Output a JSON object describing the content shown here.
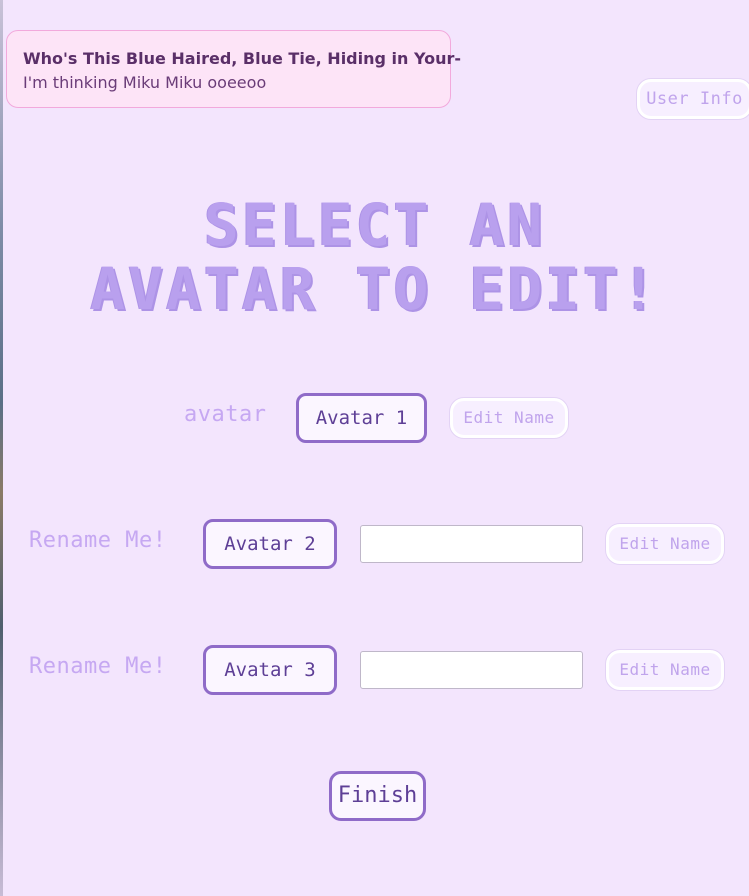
{
  "notification": {
    "title": "Who's This Blue Haired, Blue Tie, Hiding in Your-",
    "body": "I'm thinking Miku Miku ooeeoo"
  },
  "header": {
    "user_info_label": "User Info"
  },
  "main": {
    "title_line1": "SELECT AN",
    "title_line2": "AVATAR TO EDIT!",
    "rows": [
      {
        "name_label": "avatar",
        "avatar_label": "Avatar 1",
        "edit_label": "Edit Name"
      },
      {
        "name_label": "Rename Me!",
        "avatar_label": "Avatar 2",
        "input_value": "",
        "edit_label": "Edit Name"
      },
      {
        "name_label": "Rename Me!",
        "avatar_label": "Avatar 3",
        "input_value": "",
        "edit_label": "Edit Name"
      }
    ],
    "finish_label": "Finish"
  },
  "colors": {
    "background": "#f3e5fd",
    "accent_border": "#8f6bc8",
    "title": "#b9a0ee",
    "label": "#c6a8f2",
    "notification_bg": "#fde4f7",
    "notification_border": "#f2a9dc"
  }
}
